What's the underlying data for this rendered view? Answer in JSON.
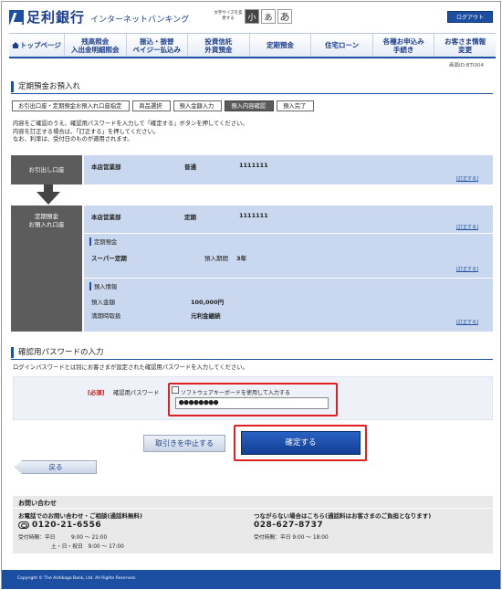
{
  "header": {
    "bank_name": "足利銀行",
    "service_name": "インターネットバンキング",
    "text_size_label": "文字サイズを変更する",
    "text_size_options": [
      "小",
      "あ",
      "あ"
    ],
    "logout_label": "ログアウト"
  },
  "nav": {
    "items": [
      {
        "label": "トップページ",
        "label2": ""
      },
      {
        "label": "残高照会",
        "label2": "入出金明細照会"
      },
      {
        "label": "振込・振替",
        "label2": "ペイジー払込み"
      },
      {
        "label": "投資信託",
        "label2": "外貨預金"
      },
      {
        "label": "定期預金",
        "label2": ""
      },
      {
        "label": "住宅ローン",
        "label2": ""
      },
      {
        "label": "各種お申込み",
        "label2": "手続き"
      },
      {
        "label": "お客さま情報",
        "label2": "変更"
      }
    ]
  },
  "screen_id": "画面ID:BTI004",
  "page": {
    "title": "定期預金お預入れ",
    "steps": [
      "お引出口座・定期預金お預入れ口座指定",
      "商品選択",
      "預入金額入力",
      "預入内容確認",
      "預入完了"
    ],
    "active_step": 3,
    "description": [
      "内容をご確認のうえ、確認用パスワードを入力して「確定する」ボタンを押してください。",
      "内容を訂正する場合は、「訂正する」を押してください。",
      "なお、利率は、受付日のものが適用されます。"
    ]
  },
  "withdrawal": {
    "label": "お引出し口座",
    "branch": "本店営業部",
    "type": "普通",
    "account": "1111111",
    "edit": "[訂正する]"
  },
  "deposit": {
    "label1": "定期預金",
    "label2": "お預入れ口座",
    "branch": "本店営業部",
    "type": "定期",
    "account": "1111111",
    "edit": "[訂正する]",
    "product_head": "定期預金",
    "product_name": "スーパー定期",
    "term_label": "預入期間",
    "term_value": "3年",
    "product_edit": "[訂正する]",
    "info_head": "預入情報",
    "amount_label": "預入金額",
    "amount_value": "100,000円",
    "maturity_label": "満期時取扱",
    "maturity_value": "元利金継続",
    "info_edit": "[訂正する]"
  },
  "password": {
    "section_title": "確認用パスワードの入力",
    "section_desc": "ログインパスワードとは別にお客さまが設定された確認用パスワードを入力してください。",
    "required": "[必須]",
    "label": "確認用パスワード",
    "software_kbd": "ソフトウェアキーボードを使用して入力する",
    "value": "●●●●●●●●"
  },
  "buttons": {
    "cancel": "取引きを中止する",
    "confirm": "確定する",
    "back": "戻る"
  },
  "contact": {
    "head": "お問い合わせ",
    "phone_title": "お電話でのお問い合わせ・ご相談(通話料無料)",
    "phone_number": "0120-21-6556",
    "hours_line1": "受付時間：平日　　　9:00 〜 21:00",
    "hours_line2": "土・日・祝日　9:00 〜 17:00",
    "alt_title": "つながらない場合はこちら(通話料はお客さまのご負担となります)",
    "alt_number": "028-627-8737",
    "alt_hours": "受付時間：平日 9:00 〜 18:00"
  },
  "footer": {
    "copyright": "Copyright © The Ashikaga Bank, Ltd. All Rights Reserved."
  }
}
